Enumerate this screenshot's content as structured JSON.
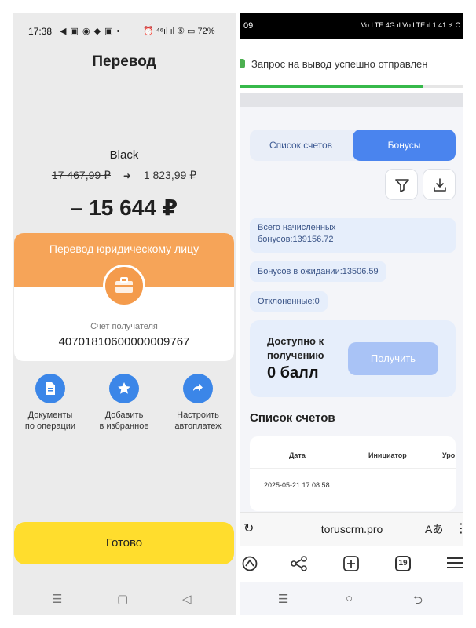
{
  "left": {
    "status": {
      "time": "17:38",
      "app_icons": "◀ ▣ ◉ ◆ ▣ •",
      "right_icons": "⏰ ⁴⁶ıl ıl ⑤ ▭ 72%"
    },
    "title": "Перевод",
    "account_name": "Black",
    "old_balance": "17 467,99 ₽",
    "new_balance": "1 823,99 ₽",
    "amount": "– 15 644 ₽",
    "card": {
      "title": "Перевод юридическому лицу",
      "recipient_label": "Счет получателя",
      "recipient_number": "40701810600000009767"
    },
    "actions": [
      {
        "line1": "Документы",
        "line2": "по операции",
        "icon": "document-icon"
      },
      {
        "line1": "Добавить",
        "line2": "в избранное",
        "icon": "star-icon"
      },
      {
        "line1": "Настроить",
        "line2": "автоплатеж",
        "icon": "repeat-icon"
      }
    ],
    "ready_button": "Готово",
    "nav": {
      "menu": "☰",
      "home": "▢",
      "back": "◁"
    }
  },
  "right": {
    "status": {
      "time": "09",
      "icons": "Vo LTE 4G ıl Vo LTE ıl 1.41 ⚡ C"
    },
    "toast": "Запрос на вывод успешно отправлен",
    "toast_progress": 0.82,
    "tabs": {
      "list": "Список счетов",
      "bonuses": "Бонусы",
      "active": "bonuses"
    },
    "total_bonuses_line1": "Всего начисленных",
    "total_bonuses_line2": "бонусов:139156.72",
    "pending_bonuses": "Бонусов в ожидании:13506.59",
    "rejected": "Отклоненные:0",
    "available": {
      "line1": "Доступно к",
      "line2": "получению",
      "value": "0 балл",
      "button": "Получить"
    },
    "accounts_title": "Список счетов",
    "table": {
      "headers": [
        "Дата",
        "Инициатор",
        "Уро"
      ],
      "rows": [
        {
          "date": "2025-05-21 17:08:58"
        }
      ]
    },
    "url_bar": {
      "reload": "↻",
      "host": "toruscrm.pro",
      "translate": "Aあ",
      "menu": "⋮"
    },
    "tab_count": "19",
    "nav": {
      "menu": "☰",
      "home": "○",
      "back": "⮌"
    }
  }
}
